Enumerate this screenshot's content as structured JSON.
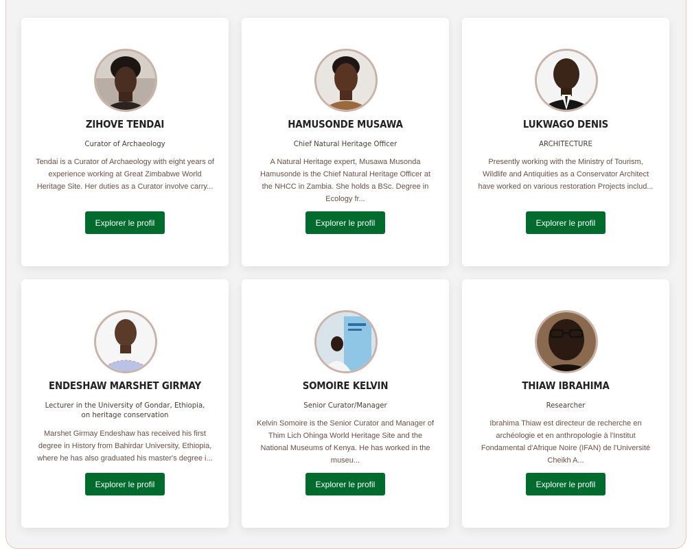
{
  "cards": [
    {
      "name": "ZIHOVE TENDAI",
      "role": "Curator of Archaeology",
      "description": "Tendai is a Curator of Archaeology with eight years of experience working at Great Zimbabwe World Heritage Site. Her duties as a Curator involve carry...",
      "button": "Explorer le profil"
    },
    {
      "name": "HAMUSONDE MUSAWA",
      "role": "Chief Natural Heritage Officer",
      "description": "A Natural Heritage expert, Musawa Musonda Hamusonde is the Chief Natural Heritage Officer at the NHCC in Zambia. She holds a BSc. Degree in Ecology fr...",
      "button": "Explorer le profil"
    },
    {
      "name": "LUKWAGO DENIS",
      "role": "ARCHITECTURE",
      "description": "Presently working with the Ministry of Tourism, Wildlife and Antiquities as a Conservator Architect have worked on various restoration Projects includ...",
      "button": "Explorer le profil"
    },
    {
      "name": "ENDESHAW MARSHET GIRMAY",
      "role": "Lecturer in the University of Gondar, Ethiopia, on heritage conservation",
      "description": "Marshet Girmay Endeshaw has received his first degree in History from Bahirdar University, Ethiopia, where he has also graduated his master's degree i...",
      "button": "Explorer le profil"
    },
    {
      "name": "SOMOIRE KELVIN",
      "role": "Senior Curator/Manager",
      "description": "Kelvin Somoire is the Senior Curator and Manager of Thim Lich Ohinga World Heritage Site and the National Museums of Kenya. He has worked in the museu...",
      "button": "Explorer le profil"
    },
    {
      "name": "THIAW IBRAHIMA",
      "role": "Researcher",
      "description": "Ibrahima Thiaw est directeur de recherche en archéologie et en anthropologie à l'Institut Fondamental d'Afrique Noire (IFAN) de l'Université Cheikh A...",
      "button": "Explorer le profil"
    }
  ]
}
